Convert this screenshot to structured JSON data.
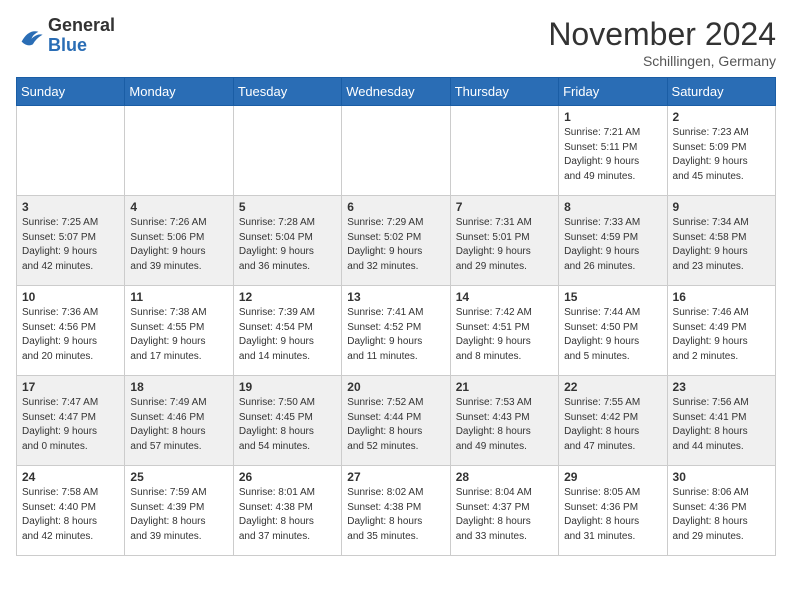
{
  "header": {
    "logo_general": "General",
    "logo_blue": "Blue",
    "month_title": "November 2024",
    "subtitle": "Schillingen, Germany"
  },
  "weekdays": [
    "Sunday",
    "Monday",
    "Tuesday",
    "Wednesday",
    "Thursday",
    "Friday",
    "Saturday"
  ],
  "weeks": [
    [
      {
        "day": "",
        "info": ""
      },
      {
        "day": "",
        "info": ""
      },
      {
        "day": "",
        "info": ""
      },
      {
        "day": "",
        "info": ""
      },
      {
        "day": "",
        "info": ""
      },
      {
        "day": "1",
        "info": "Sunrise: 7:21 AM\nSunset: 5:11 PM\nDaylight: 9 hours\nand 49 minutes."
      },
      {
        "day": "2",
        "info": "Sunrise: 7:23 AM\nSunset: 5:09 PM\nDaylight: 9 hours\nand 45 minutes."
      }
    ],
    [
      {
        "day": "3",
        "info": "Sunrise: 7:25 AM\nSunset: 5:07 PM\nDaylight: 9 hours\nand 42 minutes."
      },
      {
        "day": "4",
        "info": "Sunrise: 7:26 AM\nSunset: 5:06 PM\nDaylight: 9 hours\nand 39 minutes."
      },
      {
        "day": "5",
        "info": "Sunrise: 7:28 AM\nSunset: 5:04 PM\nDaylight: 9 hours\nand 36 minutes."
      },
      {
        "day": "6",
        "info": "Sunrise: 7:29 AM\nSunset: 5:02 PM\nDaylight: 9 hours\nand 32 minutes."
      },
      {
        "day": "7",
        "info": "Sunrise: 7:31 AM\nSunset: 5:01 PM\nDaylight: 9 hours\nand 29 minutes."
      },
      {
        "day": "8",
        "info": "Sunrise: 7:33 AM\nSunset: 4:59 PM\nDaylight: 9 hours\nand 26 minutes."
      },
      {
        "day": "9",
        "info": "Sunrise: 7:34 AM\nSunset: 4:58 PM\nDaylight: 9 hours\nand 23 minutes."
      }
    ],
    [
      {
        "day": "10",
        "info": "Sunrise: 7:36 AM\nSunset: 4:56 PM\nDaylight: 9 hours\nand 20 minutes."
      },
      {
        "day": "11",
        "info": "Sunrise: 7:38 AM\nSunset: 4:55 PM\nDaylight: 9 hours\nand 17 minutes."
      },
      {
        "day": "12",
        "info": "Sunrise: 7:39 AM\nSunset: 4:54 PM\nDaylight: 9 hours\nand 14 minutes."
      },
      {
        "day": "13",
        "info": "Sunrise: 7:41 AM\nSunset: 4:52 PM\nDaylight: 9 hours\nand 11 minutes."
      },
      {
        "day": "14",
        "info": "Sunrise: 7:42 AM\nSunset: 4:51 PM\nDaylight: 9 hours\nand 8 minutes."
      },
      {
        "day": "15",
        "info": "Sunrise: 7:44 AM\nSunset: 4:50 PM\nDaylight: 9 hours\nand 5 minutes."
      },
      {
        "day": "16",
        "info": "Sunrise: 7:46 AM\nSunset: 4:49 PM\nDaylight: 9 hours\nand 2 minutes."
      }
    ],
    [
      {
        "day": "17",
        "info": "Sunrise: 7:47 AM\nSunset: 4:47 PM\nDaylight: 9 hours\nand 0 minutes."
      },
      {
        "day": "18",
        "info": "Sunrise: 7:49 AM\nSunset: 4:46 PM\nDaylight: 8 hours\nand 57 minutes."
      },
      {
        "day": "19",
        "info": "Sunrise: 7:50 AM\nSunset: 4:45 PM\nDaylight: 8 hours\nand 54 minutes."
      },
      {
        "day": "20",
        "info": "Sunrise: 7:52 AM\nSunset: 4:44 PM\nDaylight: 8 hours\nand 52 minutes."
      },
      {
        "day": "21",
        "info": "Sunrise: 7:53 AM\nSunset: 4:43 PM\nDaylight: 8 hours\nand 49 minutes."
      },
      {
        "day": "22",
        "info": "Sunrise: 7:55 AM\nSunset: 4:42 PM\nDaylight: 8 hours\nand 47 minutes."
      },
      {
        "day": "23",
        "info": "Sunrise: 7:56 AM\nSunset: 4:41 PM\nDaylight: 8 hours\nand 44 minutes."
      }
    ],
    [
      {
        "day": "24",
        "info": "Sunrise: 7:58 AM\nSunset: 4:40 PM\nDaylight: 8 hours\nand 42 minutes."
      },
      {
        "day": "25",
        "info": "Sunrise: 7:59 AM\nSunset: 4:39 PM\nDaylight: 8 hours\nand 39 minutes."
      },
      {
        "day": "26",
        "info": "Sunrise: 8:01 AM\nSunset: 4:38 PM\nDaylight: 8 hours\nand 37 minutes."
      },
      {
        "day": "27",
        "info": "Sunrise: 8:02 AM\nSunset: 4:38 PM\nDaylight: 8 hours\nand 35 minutes."
      },
      {
        "day": "28",
        "info": "Sunrise: 8:04 AM\nSunset: 4:37 PM\nDaylight: 8 hours\nand 33 minutes."
      },
      {
        "day": "29",
        "info": "Sunrise: 8:05 AM\nSunset: 4:36 PM\nDaylight: 8 hours\nand 31 minutes."
      },
      {
        "day": "30",
        "info": "Sunrise: 8:06 AM\nSunset: 4:36 PM\nDaylight: 8 hours\nand 29 minutes."
      }
    ]
  ]
}
